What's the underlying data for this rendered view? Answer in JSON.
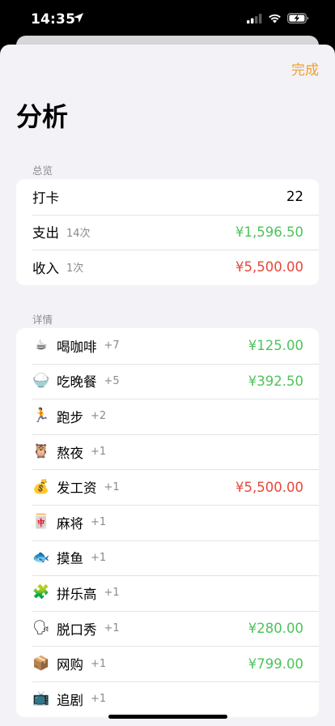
{
  "status": {
    "time": "14:35"
  },
  "nav": {
    "done_label": "完成",
    "title": "分析"
  },
  "overview": {
    "header": "总览",
    "rows": [
      {
        "label": "打卡",
        "count": "",
        "value": "22",
        "tone": "plain"
      },
      {
        "label": "支出",
        "count": "14次",
        "value": "¥1,596.50",
        "tone": "green"
      },
      {
        "label": "收入",
        "count": "1次",
        "value": "¥5,500.00",
        "tone": "red"
      }
    ]
  },
  "details": {
    "header": "详情",
    "rows": [
      {
        "emoji": "☕",
        "label": "喝咖啡",
        "count": "+7",
        "value": "¥125.00",
        "tone": "green"
      },
      {
        "emoji": "🍚",
        "label": "吃晚餐",
        "count": "+5",
        "value": "¥392.50",
        "tone": "green"
      },
      {
        "emoji": "🏃",
        "label": "跑步",
        "count": "+2",
        "value": "",
        "tone": "plain"
      },
      {
        "emoji": "🦉",
        "label": "熬夜",
        "count": "+1",
        "value": "",
        "tone": "plain"
      },
      {
        "emoji": "💰",
        "label": "发工资",
        "count": "+1",
        "value": "¥5,500.00",
        "tone": "red"
      },
      {
        "emoji": "🀄",
        "label": "麻将",
        "count": "+1",
        "value": "",
        "tone": "plain"
      },
      {
        "emoji": "🐟",
        "label": "摸鱼",
        "count": "+1",
        "value": "",
        "tone": "plain"
      },
      {
        "emoji": "🧩",
        "label": "拼乐高",
        "count": "+1",
        "value": "",
        "tone": "plain"
      },
      {
        "emoji": "🗣",
        "label": "脱口秀",
        "count": "+1",
        "value": "¥280.00",
        "tone": "green"
      },
      {
        "emoji": "📦",
        "label": "网购",
        "count": "+1",
        "value": "¥799.00",
        "tone": "green"
      },
      {
        "emoji": "📺",
        "label": "追剧",
        "count": "+1",
        "value": "",
        "tone": "plain"
      }
    ]
  },
  "icons": {
    "status": [
      "location-arrow-icon",
      "cellular-signal-icon",
      "wifi-icon",
      "battery-charging-icon"
    ]
  },
  "colors": {
    "accent": "#f0a030",
    "expense": "#4cc45a",
    "income": "#e8473b"
  }
}
